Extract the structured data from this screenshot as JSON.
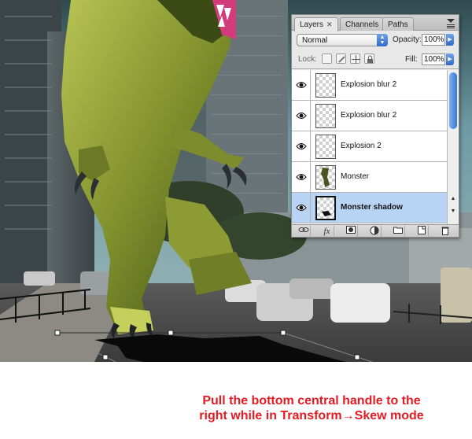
{
  "caption": {
    "line1": "Pull the bottom central handle to the",
    "line2": "right while in Transform→Skew mode"
  },
  "panel": {
    "tabs": [
      {
        "label": "Layers",
        "active": true,
        "close": "✕"
      },
      {
        "label": "Channels",
        "active": false
      },
      {
        "label": "Paths",
        "active": false
      }
    ],
    "blend_mode": "Normal",
    "opacity_label": "Opacity:",
    "opacity_value": "100%",
    "lock_label": "Lock:",
    "fill_label": "Fill:",
    "fill_value": "100%",
    "layers": [
      {
        "name": "Explosion blur 2",
        "selected": false,
        "visible": true
      },
      {
        "name": "Explosion blur 2",
        "selected": false,
        "visible": true
      },
      {
        "name": "Explosion 2",
        "selected": false,
        "visible": true
      },
      {
        "name": "Monster",
        "selected": false,
        "visible": true
      },
      {
        "name": "Monster shadow",
        "selected": true,
        "visible": true
      }
    ],
    "footer_icons": [
      "link-icon",
      "fx-icon",
      "mask-icon",
      "adjustment-icon",
      "folder-icon",
      "new-layer-icon",
      "trash-icon"
    ],
    "fx_label": "fx"
  },
  "colors": {
    "caption_red": "#e41b23",
    "selection_blue": "#b9d3f5",
    "sky": "#6f9aa5"
  }
}
